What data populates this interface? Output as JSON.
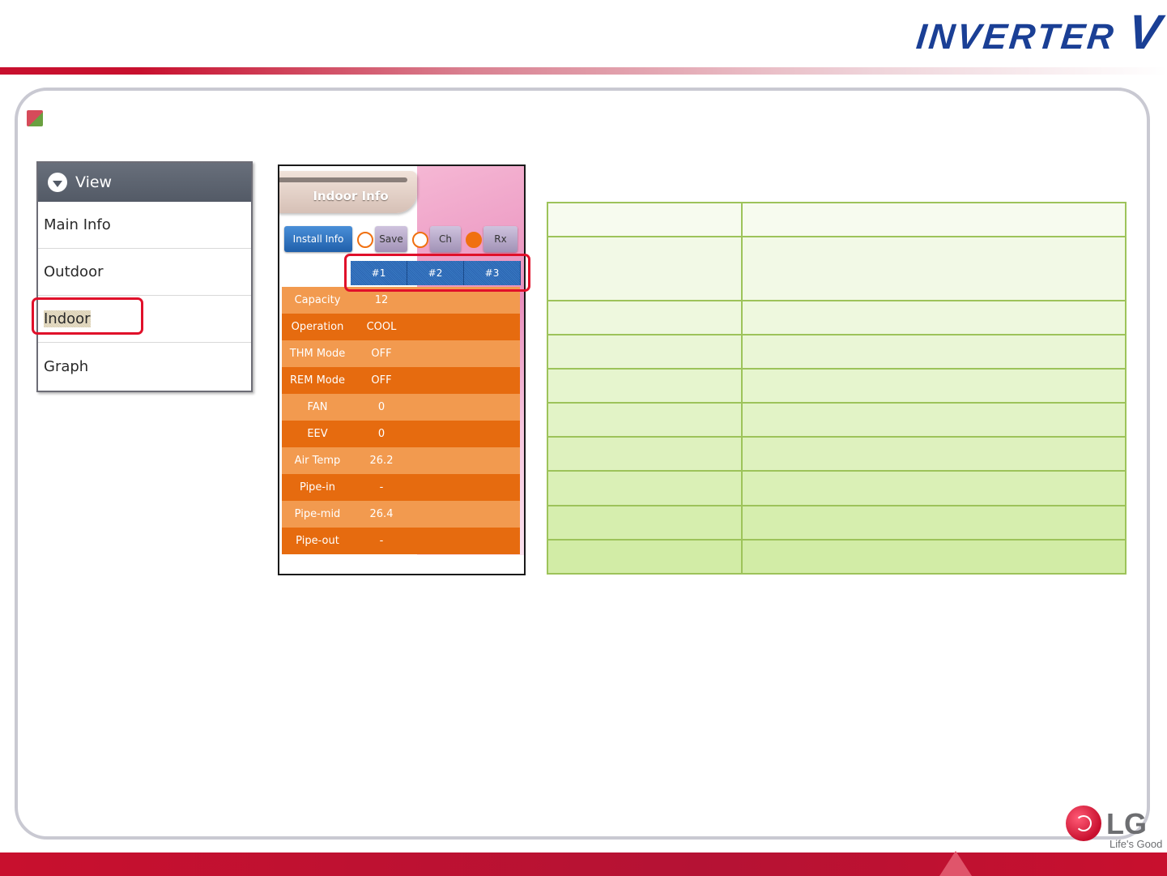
{
  "brand": {
    "name": "INVERTER",
    "mark": "V"
  },
  "view_menu": {
    "title": "View",
    "items": [
      {
        "label": "Main Info"
      },
      {
        "label": "Outdoor"
      },
      {
        "label": "Indoor"
      },
      {
        "label": "Graph"
      }
    ],
    "selected": "Indoor"
  },
  "phone": {
    "title": "Indoor Info",
    "toolbar": {
      "install": "Install Info",
      "save": "Save",
      "ch": "Ch",
      "rx": "Rx"
    },
    "unit_tabs": [
      "#1",
      "#2",
      "#3"
    ],
    "rows": [
      {
        "label": "Capacity",
        "value": "12"
      },
      {
        "label": "Operation",
        "value": "COOL"
      },
      {
        "label": "THM Mode",
        "value": "OFF"
      },
      {
        "label": "REM Mode",
        "value": "OFF"
      },
      {
        "label": "FAN",
        "value": "0"
      },
      {
        "label": "EEV",
        "value": "0"
      },
      {
        "label": "Air Temp",
        "value": "26.2"
      },
      {
        "label": "Pipe-in",
        "value": "-"
      },
      {
        "label": "Pipe-mid",
        "value": "26.4"
      },
      {
        "label": "Pipe-out",
        "value": "-"
      }
    ]
  },
  "logo": {
    "text": "LG",
    "slogan": "Life's Good"
  },
  "colors": {
    "brand_blue": "#1a3f95",
    "lg_red": "#c8102e",
    "highlight_red": "#e0102a",
    "orange": "#e66b0f",
    "table_green": "#9dc35a"
  }
}
